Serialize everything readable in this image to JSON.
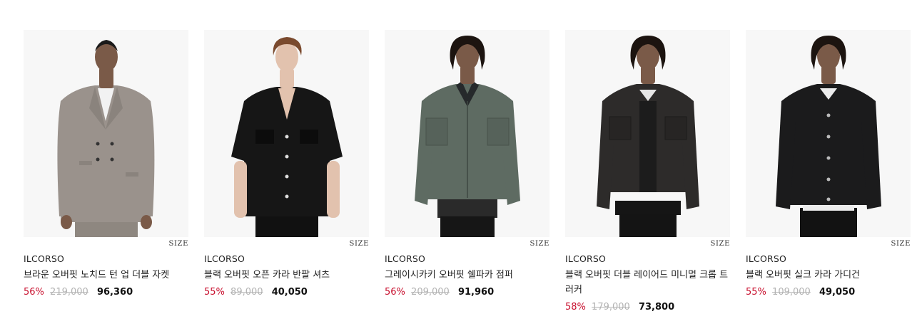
{
  "products": [
    {
      "brand": "ILCORSO",
      "name": "브라운 오버핏 노치드 턴 업 더블 자켓",
      "discount": "56%",
      "original_price": "219,000",
      "sale_price": "96,360",
      "size_label": "SIZE",
      "garment_color": "#9a928c",
      "skin_color": "#7a5a48"
    },
    {
      "brand": "ILCORSO",
      "name": "블랙 오버핏 오픈 카라 반팔 셔츠",
      "discount": "55%",
      "original_price": "89,000",
      "sale_price": "40,050",
      "size_label": "SIZE",
      "garment_color": "#161616",
      "skin_color": "#e2c2ae"
    },
    {
      "brand": "ILCORSO",
      "name": "그레이시카키 오버핏 쉘파카 점퍼",
      "discount": "56%",
      "original_price": "209,000",
      "sale_price": "91,960",
      "size_label": "SIZE",
      "garment_color": "#5e6b62",
      "skin_color": "#7a5a48"
    },
    {
      "brand": "ILCORSO",
      "name": "블랙 오버핏 더블 레이어드 미니멀 크롭 트러커",
      "discount": "58%",
      "original_price": "179,000",
      "sale_price": "73,800",
      "size_label": "SIZE",
      "garment_color": "#2d2b2a",
      "skin_color": "#7a5a48"
    },
    {
      "brand": "ILCORSO",
      "name": "블랙 오버핏 실크 카라 가디건",
      "discount": "55%",
      "original_price": "109,000",
      "sale_price": "49,050",
      "size_label": "SIZE",
      "garment_color": "#1b1b1c",
      "skin_color": "#7a5a48"
    }
  ]
}
